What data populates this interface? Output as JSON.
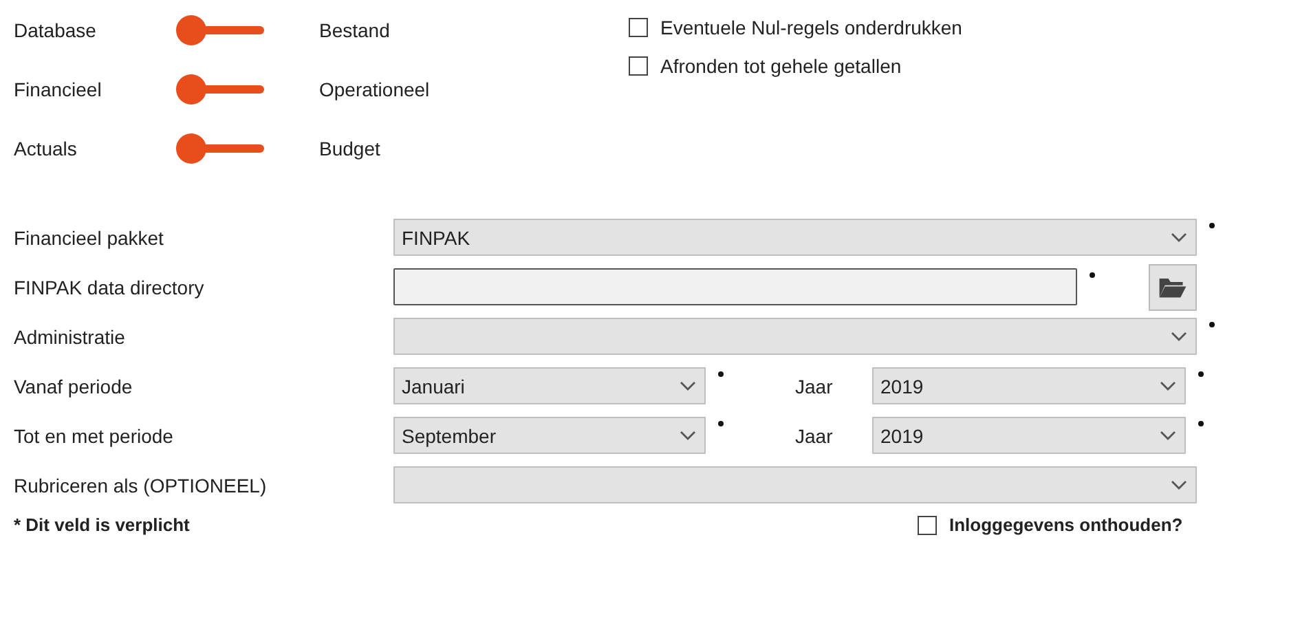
{
  "toggles": [
    {
      "left": "Database",
      "right": "Bestand",
      "on": false
    },
    {
      "left": "Financieel",
      "right": "Operationeel",
      "on": false
    },
    {
      "left": "Actuals",
      "right": "Budget",
      "on": false
    }
  ],
  "options": [
    {
      "label": "Eventuele Nul-regels onderdrukken",
      "checked": false
    },
    {
      "label": "Afronden tot gehele getallen",
      "checked": false
    }
  ],
  "fields": [
    {
      "kind": "select",
      "label": "Financieel pakket",
      "value": "FINPAK",
      "required": true
    },
    {
      "kind": "path",
      "label": "FINPAK data directory",
      "required": true
    },
    {
      "kind": "select",
      "label": "Administratie",
      "required": true
    },
    {
      "kind": "period",
      "label": "Vanaf periode",
      "value": "Januari",
      "required": true,
      "year_label": "Jaar",
      "year_value": "2019",
      "year_required": true
    },
    {
      "kind": "period",
      "label": "Tot en met periode",
      "value": "September",
      "required": true,
      "year_label": "Jaar",
      "year_value": "2019",
      "year_required": true
    },
    {
      "kind": "select",
      "label": "Rubriceren als (OPTIONEEL)",
      "required": false
    }
  ],
  "footnote": "* Dit veld is verplicht",
  "remember": {
    "label": "Inloggegevens onthouden?",
    "checked": false
  }
}
